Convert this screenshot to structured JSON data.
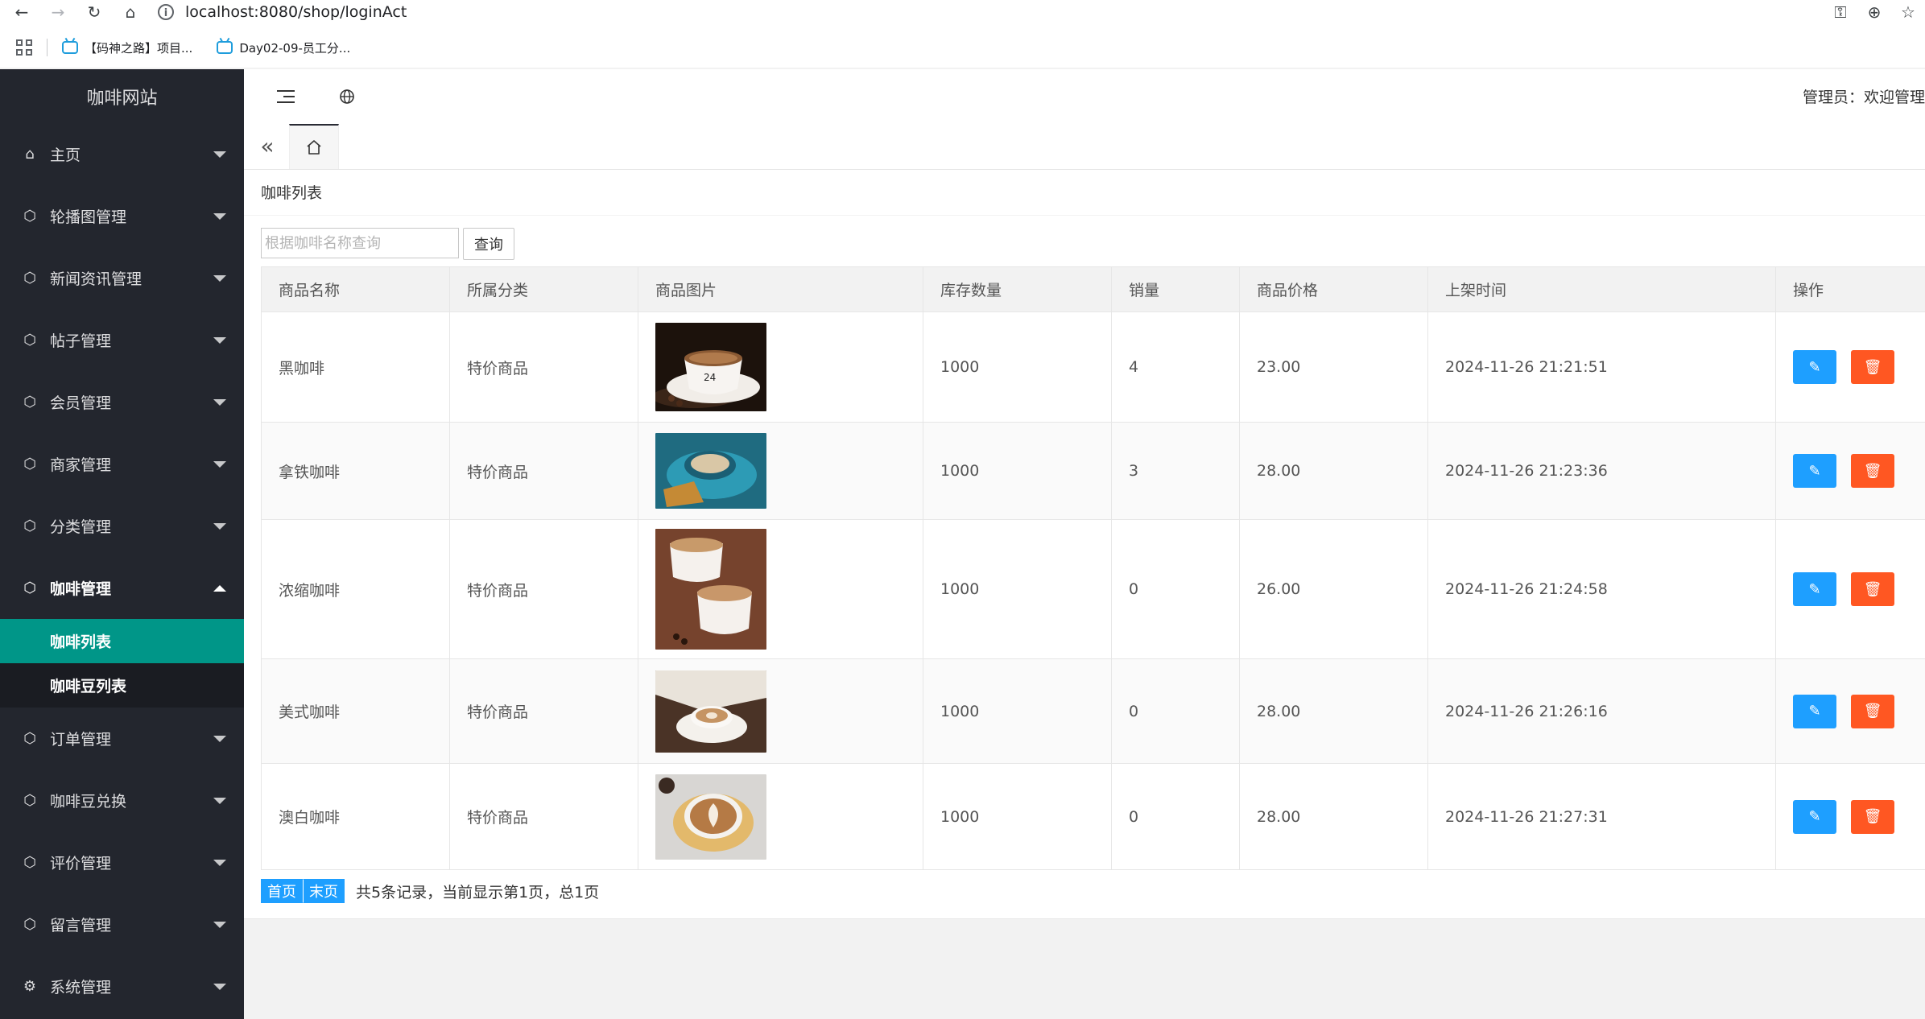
{
  "browser": {
    "url": "localhost:8080/shop/loginAct",
    "bookmarks": [
      "【码神之路】项目...",
      "Day02-09-员工分..."
    ]
  },
  "sidebar": {
    "brand": "咖啡网站",
    "items": [
      {
        "label": "主页",
        "icon": "home-icon"
      },
      {
        "label": "轮播图管理",
        "icon": "cube-icon"
      },
      {
        "label": "新闻资讯管理",
        "icon": "cube-icon"
      },
      {
        "label": "帖子管理",
        "icon": "cube-icon"
      },
      {
        "label": "会员管理",
        "icon": "cube-icon"
      },
      {
        "label": "商家管理",
        "icon": "cube-icon"
      },
      {
        "label": "分类管理",
        "icon": "cube-icon"
      },
      {
        "label": "咖啡管理",
        "icon": "cube-icon"
      }
    ],
    "submenu": [
      "咖啡列表",
      "咖啡豆列表"
    ],
    "items_after": [
      {
        "label": "订单管理",
        "icon": "cube-icon"
      },
      {
        "label": "咖啡豆兑换",
        "icon": "cube-icon"
      },
      {
        "label": "评价管理",
        "icon": "cube-icon"
      },
      {
        "label": "留言管理",
        "icon": "cube-icon"
      },
      {
        "label": "系统管理",
        "icon": "gear-icon"
      }
    ]
  },
  "header": {
    "admin_text": "管理员：欢迎管理"
  },
  "page": {
    "title": "咖啡列表",
    "search_placeholder": "根据咖啡名称查询",
    "search_button": "查询"
  },
  "table": {
    "headers": [
      "商品名称",
      "所属分类",
      "商品图片",
      "库存数量",
      "销量",
      "商品价格",
      "上架时间",
      "操作"
    ],
    "rows": [
      {
        "name": "黑咖啡",
        "category": "特价商品",
        "stock": "1000",
        "sales": "4",
        "price": "23.00",
        "time": "2024-11-26 21:21:51"
      },
      {
        "name": "拿铁咖啡",
        "category": "特价商品",
        "stock": "1000",
        "sales": "3",
        "price": "28.00",
        "time": "2024-11-26 21:23:36"
      },
      {
        "name": "浓缩咖啡",
        "category": "特价商品",
        "stock": "1000",
        "sales": "0",
        "price": "26.00",
        "time": "2024-11-26 21:24:58"
      },
      {
        "name": "美式咖啡",
        "category": "特价商品",
        "stock": "1000",
        "sales": "0",
        "price": "28.00",
        "time": "2024-11-26 21:26:16"
      },
      {
        "name": "澳白咖啡",
        "category": "特价商品",
        "stock": "1000",
        "sales": "0",
        "price": "28.00",
        "time": "2024-11-26 21:27:31"
      }
    ]
  },
  "pager": {
    "first": "首页",
    "last": "末页",
    "info": "共5条记录，当前显示第1页，总1页"
  },
  "colors": {
    "sidebar_bg": "#23262e",
    "active_green": "#009688",
    "edit_blue": "#1e9fff",
    "delete_orange": "#ff5722"
  }
}
